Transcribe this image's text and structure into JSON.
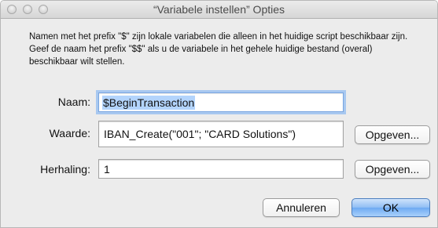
{
  "window": {
    "title": "“Variabele instellen” Opties"
  },
  "description": "Namen met het prefix \"$\" zijn lokale variabelen die alleen in het huidige script beschikbaar zijn. Geef de naam het prefix \"$$\" als u de variabele in het gehele huidige bestand (overal) beschikbaar wilt stellen.",
  "form": {
    "name_label": "Naam:",
    "name_value": "$BeginTransaction",
    "value_label": "Waarde:",
    "value_value": "IBAN_Create(\"001\"; \"CARD Solutions\")",
    "value_specify": "Opgeven...",
    "repetition_label": "Herhaling:",
    "repetition_value": "1",
    "repetition_specify": "Opgeven..."
  },
  "buttons": {
    "cancel": "Annuleren",
    "ok": "OK"
  }
}
